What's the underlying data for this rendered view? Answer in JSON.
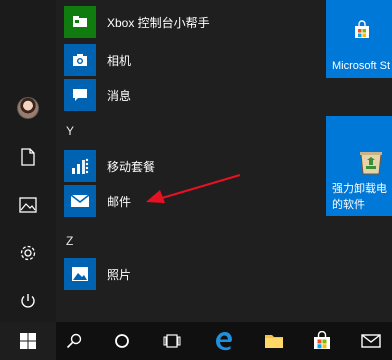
{
  "start_menu": {
    "app_list": {
      "items_top": [
        {
          "label": "Xbox 控制台小帮手",
          "icon": "xbox-icon"
        },
        {
          "label": "相机",
          "icon": "camera-icon"
        },
        {
          "label": "消息",
          "icon": "message-icon"
        }
      ],
      "group_y": {
        "letter": "Y",
        "items": [
          {
            "label": "移动套餐",
            "icon": "mobile-plans-icon"
          },
          {
            "label": "邮件",
            "icon": "mail-icon"
          }
        ]
      },
      "group_z": {
        "letter": "Z",
        "items": [
          {
            "label": "照片",
            "icon": "photos-icon"
          }
        ]
      }
    },
    "tiles": {
      "store": {
        "label": "Microsoft St",
        "icon": "store-bag-icon"
      },
      "uninstaller": {
        "label_line1": "强力卸载电",
        "label_line2": "的软件",
        "icon": "recycle-bin-icon"
      }
    },
    "rail_icons": [
      "user-avatar",
      "documents-icon",
      "pictures-icon",
      "settings-icon",
      "power-icon"
    ]
  },
  "taskbar": {
    "icons": [
      "windows-start-icon",
      "search-icon",
      "cortana-circle-icon",
      "task-view-icon",
      "edge-icon",
      "file-explorer-icon",
      "store-icon",
      "file-explorer-window-icon",
      "mail-icon"
    ]
  },
  "annotation": {
    "arrow_color": "#e81123"
  },
  "colors": {
    "tile_blue": "#0078d7",
    "app_tile_blue": "#0063b1",
    "xbox_green": "#107c10",
    "background": "#1f1f1f"
  }
}
